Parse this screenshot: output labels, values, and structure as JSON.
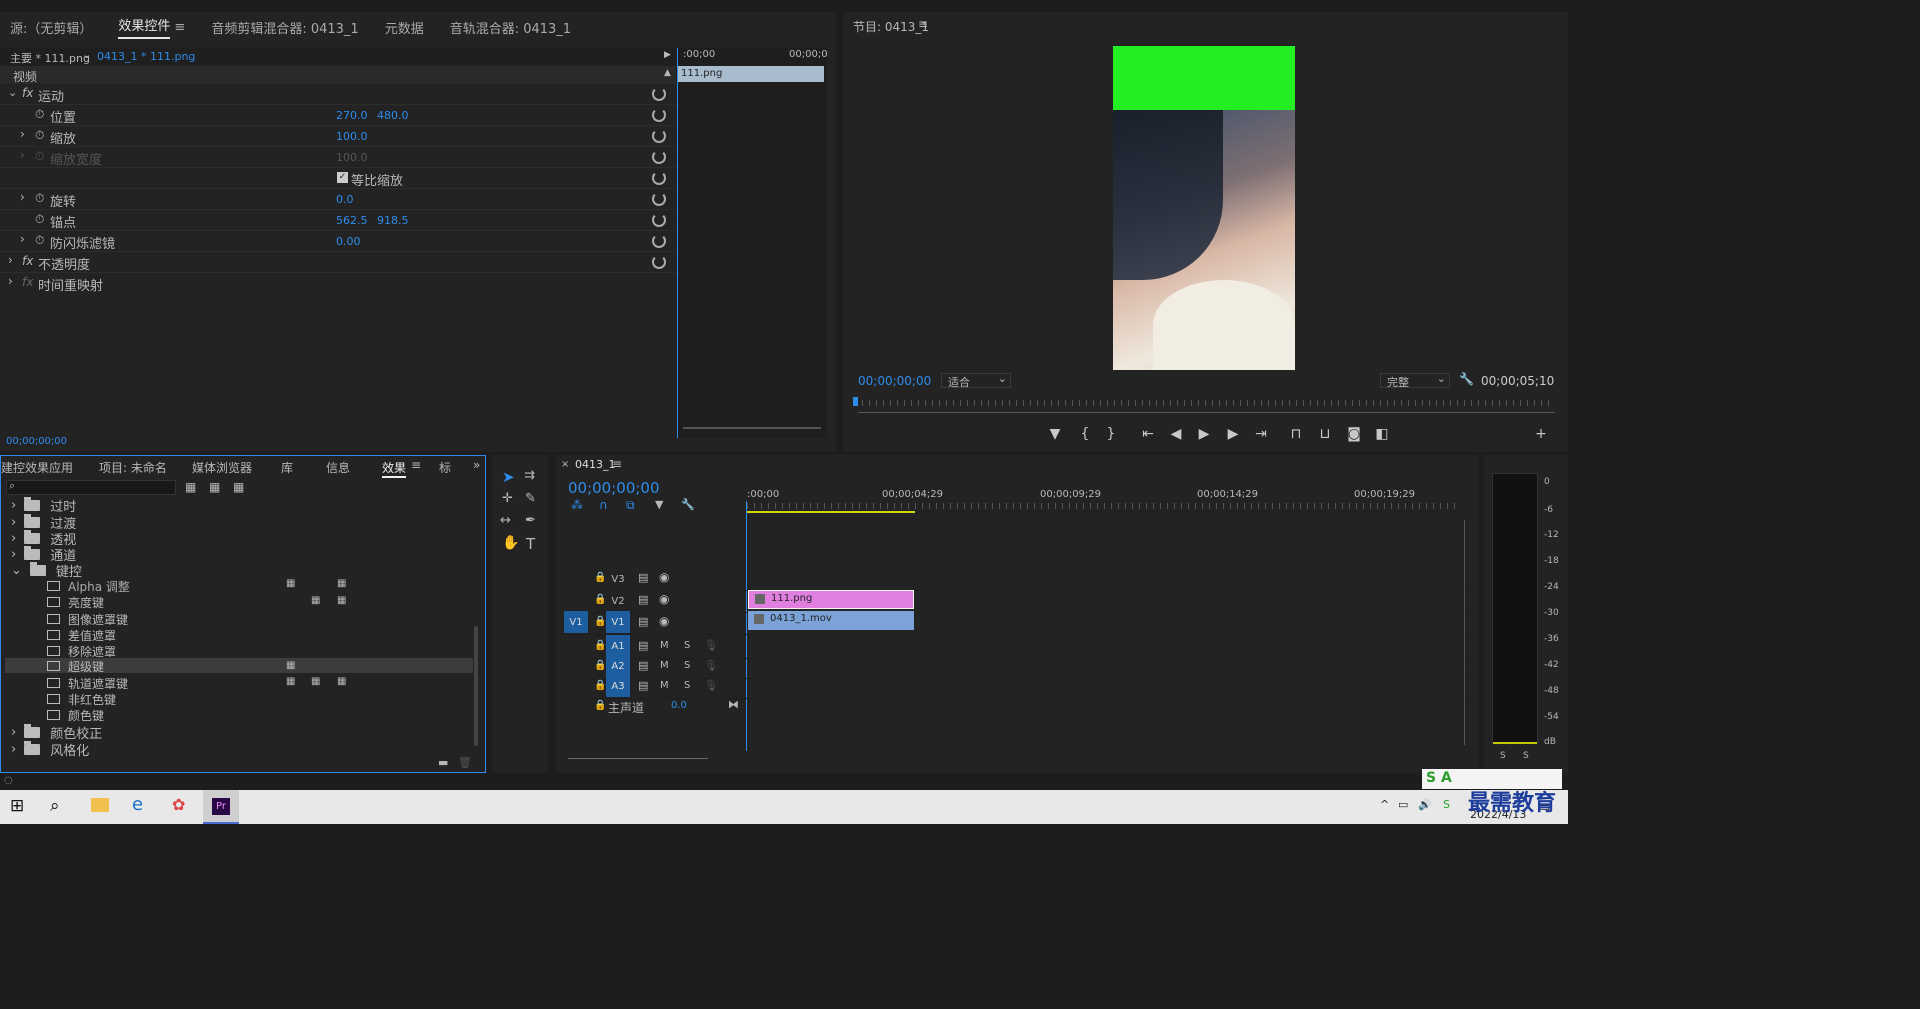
{
  "source_panel": {
    "tabs": [
      "源:（无剪辑）",
      "效果控件",
      "音频剪辑混合器: 0413_1",
      "元数据",
      "音轨混合器: 0413_1"
    ],
    "active_tab_index": 1,
    "clip_path": "主要 * 111.png",
    "clip_dropdown": "0413_1 * 111.png",
    "section_video": "视频",
    "rows": [
      {
        "label": "运动",
        "fx": true
      },
      {
        "label": "位置",
        "v1": "270.0",
        "v2": "480.0"
      },
      {
        "label": "缩放",
        "v1": "100.0"
      },
      {
        "label": "缩放宽度",
        "v1": "100.0",
        "disabled": true
      },
      {
        "label": "等比缩放",
        "checkbox": true
      },
      {
        "label": "旋转",
        "v1": "0.0"
      },
      {
        "label": "锚点",
        "v1": "562.5",
        "v2": "918.5"
      },
      {
        "label": "防闪烁滤镜",
        "v1": "0.00"
      },
      {
        "label": "不透明度",
        "fx": true
      },
      {
        "label": "时间重映射",
        "fx": true
      }
    ],
    "mini_timeline": {
      "start": ":00;00",
      "end": "00;00;0",
      "clip": "111.png"
    },
    "timecode": "00;00;00;00"
  },
  "program_panel": {
    "title": "节目: 0413_1",
    "timecode": "00;00;00;00",
    "fit": "适合",
    "quality": "完整",
    "duration": "00;00;05;10",
    "colors": {
      "green": "#22ee22"
    }
  },
  "effects_panel": {
    "tabs": [
      "建控效果应用",
      "项目: 未命名",
      "媒体浏览器",
      "库",
      "信息",
      "效果",
      "标"
    ],
    "active_tab_index": 5,
    "search_placeholder": "",
    "tree": [
      {
        "label": "过时",
        "type": "folder",
        "open": false
      },
      {
        "label": "过渡",
        "type": "folder",
        "open": false
      },
      {
        "label": "透视",
        "type": "folder",
        "open": false
      },
      {
        "label": "通道",
        "type": "folder",
        "open": false
      },
      {
        "label": "键控",
        "type": "folder",
        "open": true
      },
      {
        "label": "Alpha 调整",
        "type": "fx"
      },
      {
        "label": "亮度键",
        "type": "fx"
      },
      {
        "label": "图像遮罩键",
        "type": "fx"
      },
      {
        "label": "差值遮罩",
        "type": "fx"
      },
      {
        "label": "移除遮罩",
        "type": "fx"
      },
      {
        "label": "超级键",
        "type": "fx",
        "selected": true
      },
      {
        "label": "轨道遮罩键",
        "type": "fx"
      },
      {
        "label": "非红色键",
        "type": "fx"
      },
      {
        "label": "颜色键",
        "type": "fx"
      },
      {
        "label": "颜色校正",
        "type": "folder",
        "open": false
      },
      {
        "label": "风格化",
        "type": "folder",
        "open": false
      }
    ]
  },
  "timeline": {
    "sequence": "0413_1",
    "timecode": "00;00;00;00",
    "ruler": [
      ":00;00",
      "00;00;04;29",
      "00;00;09;29",
      "00;00;14;29",
      "00;00;19;29"
    ],
    "tracks": {
      "v3": "V3",
      "v2": "V2",
      "v1": "V1",
      "v1_src": "V1",
      "a1": "A1",
      "a2": "A2",
      "a3": "A3",
      "m": "M",
      "s": "S",
      "master": "主声道",
      "master_val": "0.0"
    },
    "clips": [
      {
        "name": "111.png",
        "track": "V2",
        "color": "#e07fe0"
      },
      {
        "name": "0413_1.mov",
        "track": "V1",
        "color": "#7ba3d8"
      }
    ]
  },
  "audio_meter": {
    "scale": [
      "0",
      "-6",
      "-12",
      "-18",
      "-24",
      "-30",
      "-36",
      "-42",
      "-48",
      "-54",
      "dB"
    ],
    "solo": [
      "S",
      "S"
    ]
  },
  "taskbar": {
    "date": "2022/4/13",
    "watermark": "最需教育",
    "ime": "S A"
  }
}
